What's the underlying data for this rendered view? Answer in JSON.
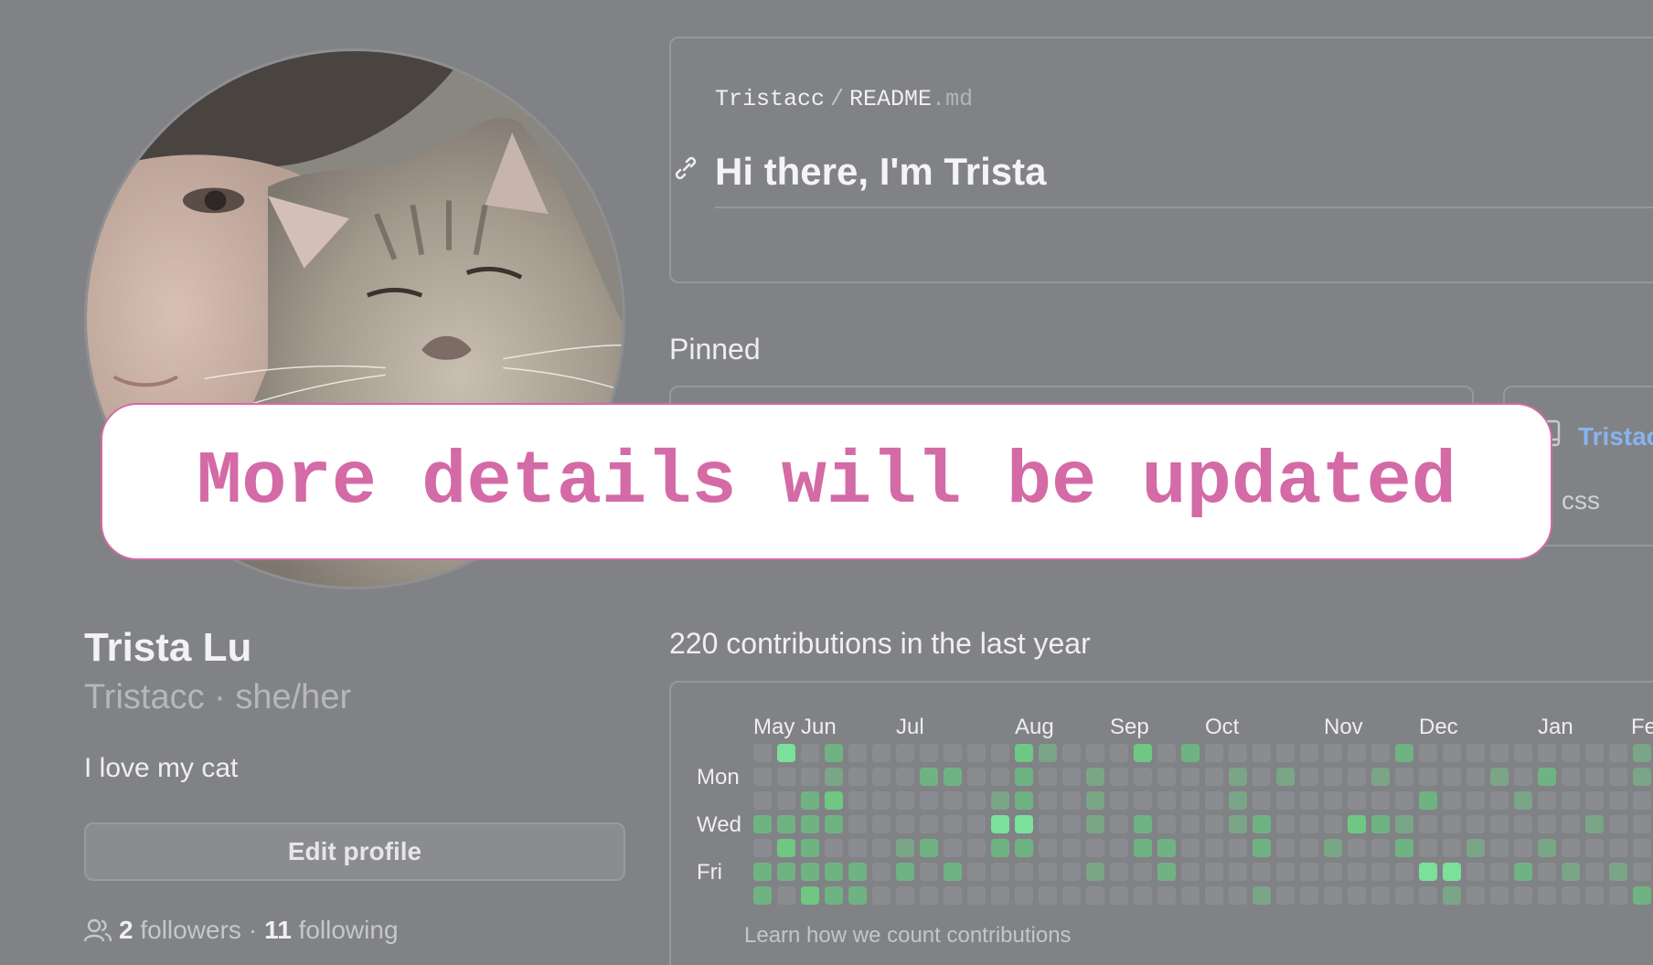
{
  "profile": {
    "name": "Trista Lu",
    "username_pronouns": "Tristacc · she/her",
    "bio": "I love my cat",
    "edit_button": "Edit profile",
    "followers_count": "2",
    "followers_label": "followers",
    "separator": "·",
    "following_count": "11",
    "following_label": "following"
  },
  "readme": {
    "owner": "Tristacc",
    "separator": "/",
    "file": "README",
    "ext": ".md",
    "heading": "Hi there, I'm Trista"
  },
  "pinned": {
    "label": "Pinned",
    "repo_name": "Tristac",
    "repo_language": "css"
  },
  "banner": {
    "text": "More details will be updated"
  },
  "contributions": {
    "title": "220 contributions in the last year",
    "months": [
      "May",
      "Jun",
      "Jul",
      "Aug",
      "Sep",
      "Oct",
      "Nov",
      "Dec",
      "Jan",
      "Fe"
    ],
    "day_labels": [
      "Mon",
      "Wed",
      "Fri"
    ],
    "learn_link": "Learn how we count contributions",
    "levels": {
      "1": [
        [
          3,
          1
        ],
        [
          3,
          2
        ],
        [
          6,
          4
        ],
        [
          6,
          5
        ],
        [
          10,
          2
        ],
        [
          10,
          3
        ],
        [
          10,
          4
        ],
        [
          12,
          0
        ],
        [
          14,
          5
        ],
        [
          14,
          1
        ],
        [
          14,
          2
        ],
        [
          14,
          3
        ],
        [
          20,
          1
        ],
        [
          20,
          2
        ],
        [
          20,
          3
        ],
        [
          21,
          6
        ],
        [
          29,
          6
        ],
        [
          30,
          4
        ],
        [
          32,
          2
        ],
        [
          27,
          3
        ],
        [
          26,
          1
        ],
        [
          28,
          5
        ],
        [
          31,
          1
        ],
        [
          33,
          4
        ],
        [
          22,
          1
        ],
        [
          24,
          4
        ],
        [
          45,
          2
        ],
        [
          42,
          5
        ],
        [
          47,
          0
        ],
        [
          47,
          5
        ],
        [
          50,
          4
        ],
        [
          51,
          3
        ],
        [
          53,
          1
        ],
        [
          54,
          5
        ],
        [
          37,
          0
        ],
        [
          37,
          1
        ],
        [
          35,
          3
        ],
        [
          36,
          5
        ],
        [
          34,
          5
        ],
        [
          40,
          1
        ],
        [
          40,
          3
        ],
        [
          41,
          0
        ],
        [
          44,
          2
        ],
        [
          46,
          3
        ],
        [
          48,
          1
        ],
        [
          52,
          3
        ],
        [
          55,
          4
        ]
      ],
      "2": [
        [
          0,
          3
        ],
        [
          0,
          5
        ],
        [
          0,
          6
        ],
        [
          1,
          3
        ],
        [
          1,
          5
        ],
        [
          2,
          2
        ],
        [
          2,
          3
        ],
        [
          2,
          4
        ],
        [
          2,
          5
        ],
        [
          3,
          0
        ],
        [
          3,
          3
        ],
        [
          3,
          5
        ],
        [
          3,
          6
        ],
        [
          4,
          5
        ],
        [
          4,
          6
        ],
        [
          6,
          5
        ],
        [
          7,
          1
        ],
        [
          7,
          4
        ],
        [
          8,
          1
        ],
        [
          8,
          5
        ],
        [
          10,
          4
        ],
        [
          11,
          2
        ],
        [
          11,
          4
        ],
        [
          11,
          1
        ],
        [
          16,
          4
        ],
        [
          16,
          3
        ],
        [
          17,
          4
        ],
        [
          17,
          5
        ],
        [
          18,
          0
        ],
        [
          21,
          4
        ],
        [
          21,
          3
        ],
        [
          26,
          3
        ],
        [
          27,
          4
        ],
        [
          27,
          0
        ],
        [
          33,
          1
        ],
        [
          37,
          6
        ],
        [
          38,
          6
        ],
        [
          39,
          4
        ],
        [
          25,
          3
        ],
        [
          28,
          2
        ],
        [
          32,
          5
        ]
      ],
      "3": [
        [
          1,
          0
        ],
        [
          1,
          4
        ],
        [
          2,
          6
        ],
        [
          3,
          2
        ],
        [
          10,
          3
        ],
        [
          11,
          3
        ],
        [
          11,
          0
        ],
        [
          16,
          0
        ],
        [
          25,
          3
        ],
        [
          28,
          5
        ],
        [
          29,
          5
        ],
        [
          38,
          0
        ],
        [
          38,
          1
        ]
      ],
      "4": [
        [
          1,
          0
        ],
        [
          10,
          3
        ],
        [
          11,
          3
        ],
        [
          28,
          5
        ],
        [
          29,
          5
        ]
      ]
    },
    "colors": [
      "#8b8c90",
      "#7aa586",
      "#6fb383",
      "#6ec884",
      "#7ae09a"
    ]
  }
}
